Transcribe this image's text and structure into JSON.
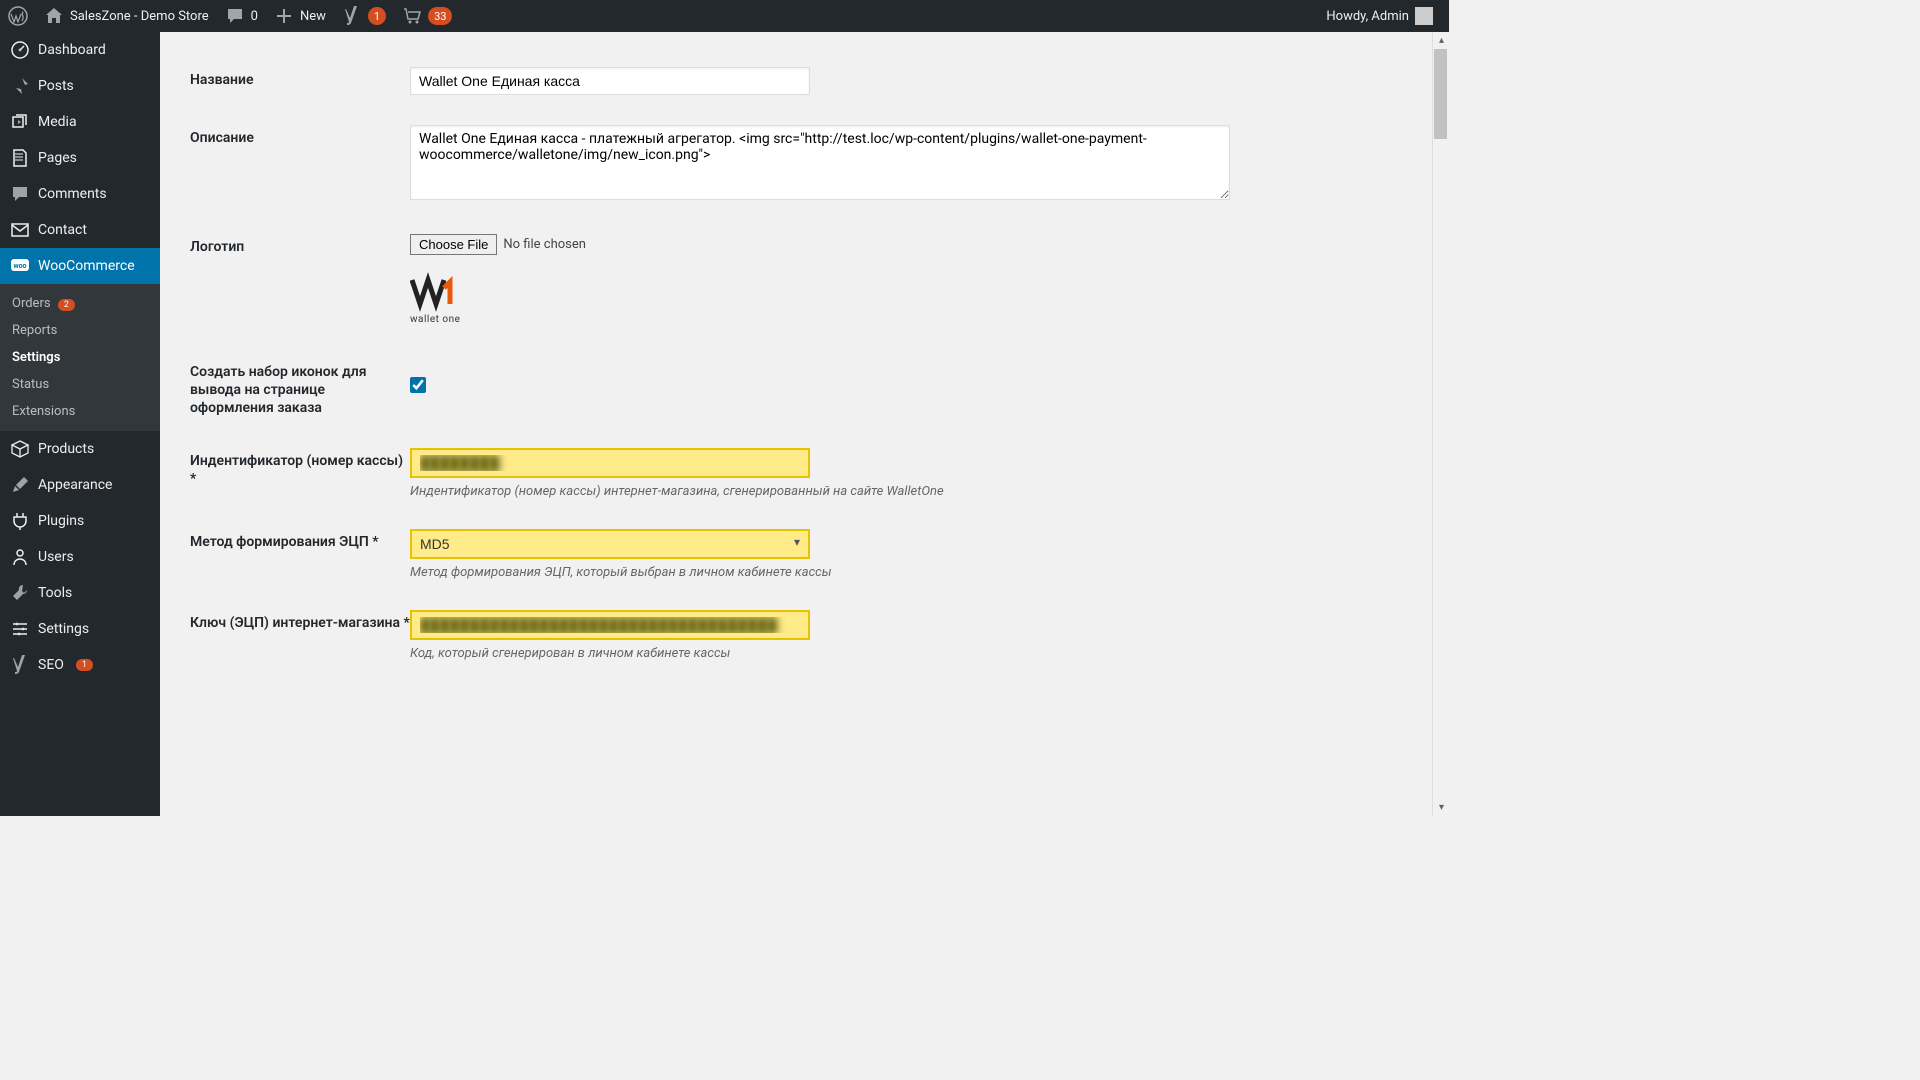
{
  "adminbar": {
    "site_title": "SalesZone - Demo Store",
    "comments_count": "0",
    "new_label": "New",
    "yoast_count": "1",
    "cart_count": "33",
    "howdy": "Howdy, Admin"
  },
  "sidebar": {
    "items": [
      {
        "label": "Dashboard"
      },
      {
        "label": "Posts"
      },
      {
        "label": "Media"
      },
      {
        "label": "Pages"
      },
      {
        "label": "Comments"
      },
      {
        "label": "Contact"
      },
      {
        "label": "WooCommerce"
      },
      {
        "label": "Products"
      },
      {
        "label": "Appearance"
      },
      {
        "label": "Plugins"
      },
      {
        "label": "Users"
      },
      {
        "label": "Tools"
      },
      {
        "label": "Settings"
      },
      {
        "label": "SEO",
        "count": "1"
      }
    ],
    "woocommerce_submenu": [
      {
        "label": "Orders",
        "count": "2"
      },
      {
        "label": "Reports"
      },
      {
        "label": "Settings"
      },
      {
        "label": "Status"
      },
      {
        "label": "Extensions"
      }
    ]
  },
  "form": {
    "title_label": "Название",
    "title_value": "Wallet One Единая касса",
    "desc_label": "Описание",
    "desc_value": "Wallet One Единая касса - платежный агрегатор. <img src=\"http://test.loc/wp-content/plugins/wallet-one-payment-woocommerce/walletone/img/new_icon.png\">",
    "logo_label": "Логотип",
    "choose_file_btn": "Choose File",
    "no_file": "No file chosen",
    "logo_brand": "wallet one",
    "iconset_label": "Создать набор иконок для вывода на странице оформления заказа",
    "merchant_id_label": "Индентификатор (номер кассы) *",
    "merchant_id_value": "████████",
    "merchant_id_help": "Индентификатор (номер кассы) интернет-магазина, сгенерированный на сайте WalletOne",
    "sig_method_label": "Метод формирования ЭЦП *",
    "sig_method_value": "MD5",
    "sig_method_help": "Метод формирования ЭЦП, который выбран в личном кабинете кассы",
    "key_label": "Ключ (ЭЦП) интернет-магазина *",
    "key_value": "████████████████████████████████████",
    "key_help": "Код, который сгенерирован в личном кабинете кассы"
  }
}
